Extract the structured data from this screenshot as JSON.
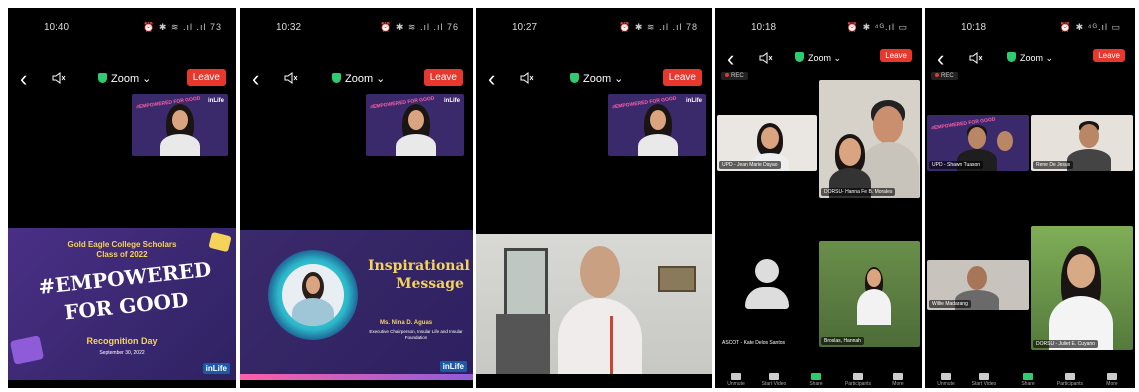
{
  "panels": [
    {
      "time": "10:40",
      "status_icons": "⏰ ✱ ≋ .ıl .ıl 73",
      "zoom_label": "Zoom ⌄",
      "leave_label": "Leave",
      "thumb_tag": "#EMPOWERED FOR GOOD",
      "thumb_logo": "inLife",
      "slide": {
        "org": "Gold Eagle College Scholars",
        "class": "Class of 2022",
        "headline1": "#EMPOWERED",
        "headline2": "FOR GOOD",
        "event": "Recognition Day",
        "date": "September 30, 2022",
        "logo": "inLife"
      }
    },
    {
      "time": "10:32",
      "status_icons": "⏰ ✱ ≋ .ıl .ıl 76",
      "zoom_label": "Zoom ⌄",
      "leave_label": "Leave",
      "thumb_tag": "#EMPOWERED FOR GOOD",
      "thumb_logo": "inLife",
      "slide": {
        "title1": "Inspirational",
        "title2": "Message",
        "speaker": "Ms. Nina D. Aguas",
        "role": "Executive Chairperson, Insular Life and Insular Foundation",
        "logo": "inLife"
      }
    },
    {
      "time": "10:27",
      "status_icons": "⏰ ✱ ≋ .ıl .ıl 78",
      "zoom_label": "Zoom ⌄",
      "leave_label": "Leave",
      "thumb_tag": "#EMPOWERED FOR GOOD",
      "thumb_logo": "inLife"
    },
    {
      "time": "10:18",
      "status_icons": "⏰ ✱ ⁴ᴳ.ıl ▭",
      "zoom_label": "Zoom ⌄",
      "leave_label": "Leave",
      "rec_label": "REC",
      "tiles": [
        "UPD - Jean Marie Dayao",
        "DORSU- Hanna Fe B. Morales",
        "ASCOT - Kate Delos Santos",
        "Broslas, Hannah"
      ],
      "bottom": [
        "Unmute",
        "Start Video",
        "Share",
        "Participants",
        "More"
      ],
      "participants_count": "25"
    },
    {
      "time": "10:18",
      "status_icons": "⏰ ✱ ⁴ᴳ.ıl ▭",
      "zoom_label": "Zoom ⌄",
      "leave_label": "Leave",
      "rec_label": "REC",
      "tiles": [
        "UPD - Shawn Tuason",
        "Rene De Jesus",
        "Willie Madarang",
        "DORSU - Juliet E. Cuyano"
      ],
      "thumb_tag": "#EMPOWERED FOR GOOD",
      "bottom": [
        "Unmute",
        "Start Video",
        "Share",
        "Participants",
        "More"
      ],
      "participants_count": "25"
    }
  ],
  "colors": {
    "leave": "#e8372d",
    "shield": "#2ecc71",
    "slide_purple": "#3b2a6b",
    "accent_pink": "#ff5fa8",
    "accent_yellow": "#f5d35a"
  }
}
